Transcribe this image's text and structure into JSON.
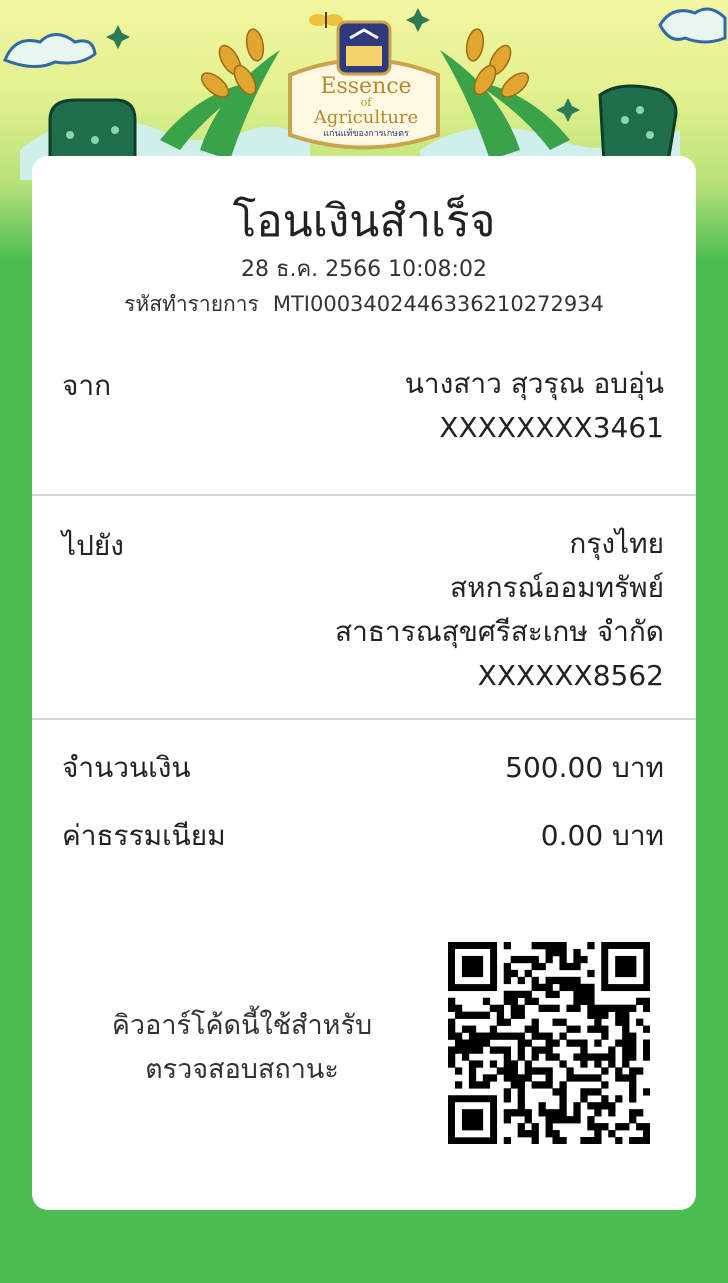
{
  "banner": {
    "logo_line1": "Essence",
    "logo_of": "of",
    "logo_line2": "Agriculture",
    "logo_sub": "แก่นแท้ของการเกษตร"
  },
  "receipt": {
    "title": "โอนเงินสำเร็จ",
    "datetime": "28 ธ.ค. 2566 10:08:02",
    "txn_label": "รหัสทำรายการ",
    "txn_id": "MTI0003402446336210272934"
  },
  "from": {
    "label": "จาก",
    "name": "นางสาว สุวรุณ อบอุ่น",
    "account": "XXXXXXXX3461"
  },
  "to": {
    "label": "ไปยัง",
    "bank": "กรุงไทย",
    "name_line1": "สหกรณ์ออมทรัพย์",
    "name_line2": "สาธารณสุขศรีสะเกษ จำกัด",
    "account": "XXXXXX8562"
  },
  "amount": {
    "label": "จำนวนเงิน",
    "value": "500.00 บาท"
  },
  "fee": {
    "label": "ค่าธรรมเนียม",
    "value": "0.00 บาท"
  },
  "qr": {
    "line1": "คิวอาร์โค้ดนี้ใช้สำหรับ",
    "line2": "ตรวจสอบสถานะ",
    "icon": "qr-code-icon"
  },
  "colors": {
    "background": "#4cbd51",
    "card": "#ffffff",
    "logo_gold": "#c9a44c",
    "logo_navy": "#2f3a7d"
  }
}
